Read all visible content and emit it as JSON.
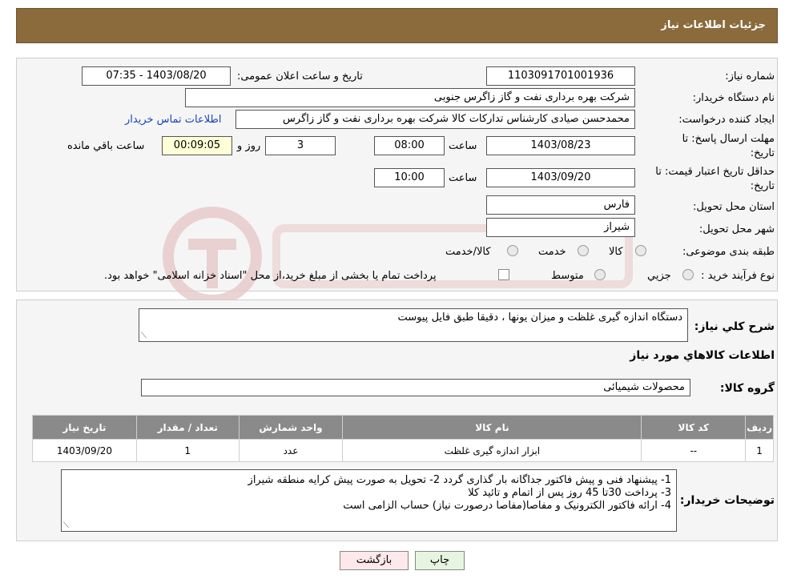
{
  "header": {
    "title": "جزئیات اطلاعات نیاز"
  },
  "fields": {
    "need_number_label": "شماره نیاز:",
    "need_number": "1103091701001936",
    "announce_label": "تاریخ و ساعت اعلان عمومی:",
    "announce_value": "1403/08/20 - 07:35",
    "buyer_org_label": "نام دستگاه خریدار:",
    "buyer_org": "شرکت بهره برداری نفت و گاز زاگرس جنوبی",
    "creator_label": "ایجاد کننده درخواست:",
    "creator": "محمدحسن صیادی کارشناس تدارکات کالا شرکت بهره برداری نفت و گاز زاگرس",
    "contact_link": "اطلاعات تماس خریدار",
    "deadline_label_1": "مهلت ارسال پاسخ: تا",
    "deadline_label_2": "تاریخ:",
    "deadline_date": "1403/08/23",
    "time_label": "ساعت",
    "deadline_time": "08:00",
    "days_value": "3",
    "day_and_label": "روز و",
    "countdown": "00:09:05",
    "remaining_label": "ساعت باقي مانده",
    "validity_label_1": "حداقل تاریخ اعتبار قیمت: تا",
    "validity_label_2": "تاریخ:",
    "validity_date": "1403/09/20",
    "validity_time": "10:00",
    "province_label": "استان محل تحویل:",
    "province": "فارس",
    "city_label": "شهر محل تحویل:",
    "city": "شیراز",
    "category_label": "طبقه بندی موضوعی:",
    "category_options": [
      "کالا",
      "خدمت",
      "کالا/خدمت"
    ],
    "process_label": "نوع فرآیند خرید :",
    "process_options": [
      "جزيي",
      "متوسط"
    ],
    "payment_note": "پرداخت تمام یا بخشی از مبلغ خرید،از محل \"اسناد خزانه اسلامی\" خواهد بود."
  },
  "description": {
    "label": "شرح کلي نياز:",
    "value": "دستگاه اندازه گیری غلظت و میزان یونها ، دقیقا طبق فایل پیوست"
  },
  "goods_section": {
    "title": "اطلاعات کالاهاي مورد نياز",
    "group_label": "گروه کالا:",
    "group_value": "محصولات شیمیائی"
  },
  "table": {
    "headers": [
      "رديف",
      "کد کالا",
      "نام کالا",
      "واحد شمارش",
      "تعداد / مقدار",
      "تاریخ نیاز"
    ],
    "rows": [
      [
        "1",
        "--",
        "ابزار اندازه گیری غلظت",
        "عدد",
        "1",
        "1403/09/20"
      ]
    ]
  },
  "buyer_notes": {
    "label": "توضیحات خریدار:",
    "lines": [
      "1- پیشنهاد فنی و پیش فاکتور  جداگانه  بار گذاری گردد 2- تحویل به صورت پیش کرایه منطقه شیراز",
      "3- پرداخت 30تا 45 روز پس از اتمام و تائید کلا",
      "4- ارائه فاکتور الکترونیک  و مفاصا(مفاصا درصورت نیاز) حساب  الزامی است"
    ]
  },
  "buttons": {
    "print": "چاپ",
    "back": "بازگشت"
  },
  "colors": {
    "header_bg": "#8b6a3c",
    "table_header_bg": "#8a8a8a",
    "link": "#1a44b8",
    "back_button_bg": "#fde8ec",
    "print_button_bg": "#e6f5e0"
  }
}
